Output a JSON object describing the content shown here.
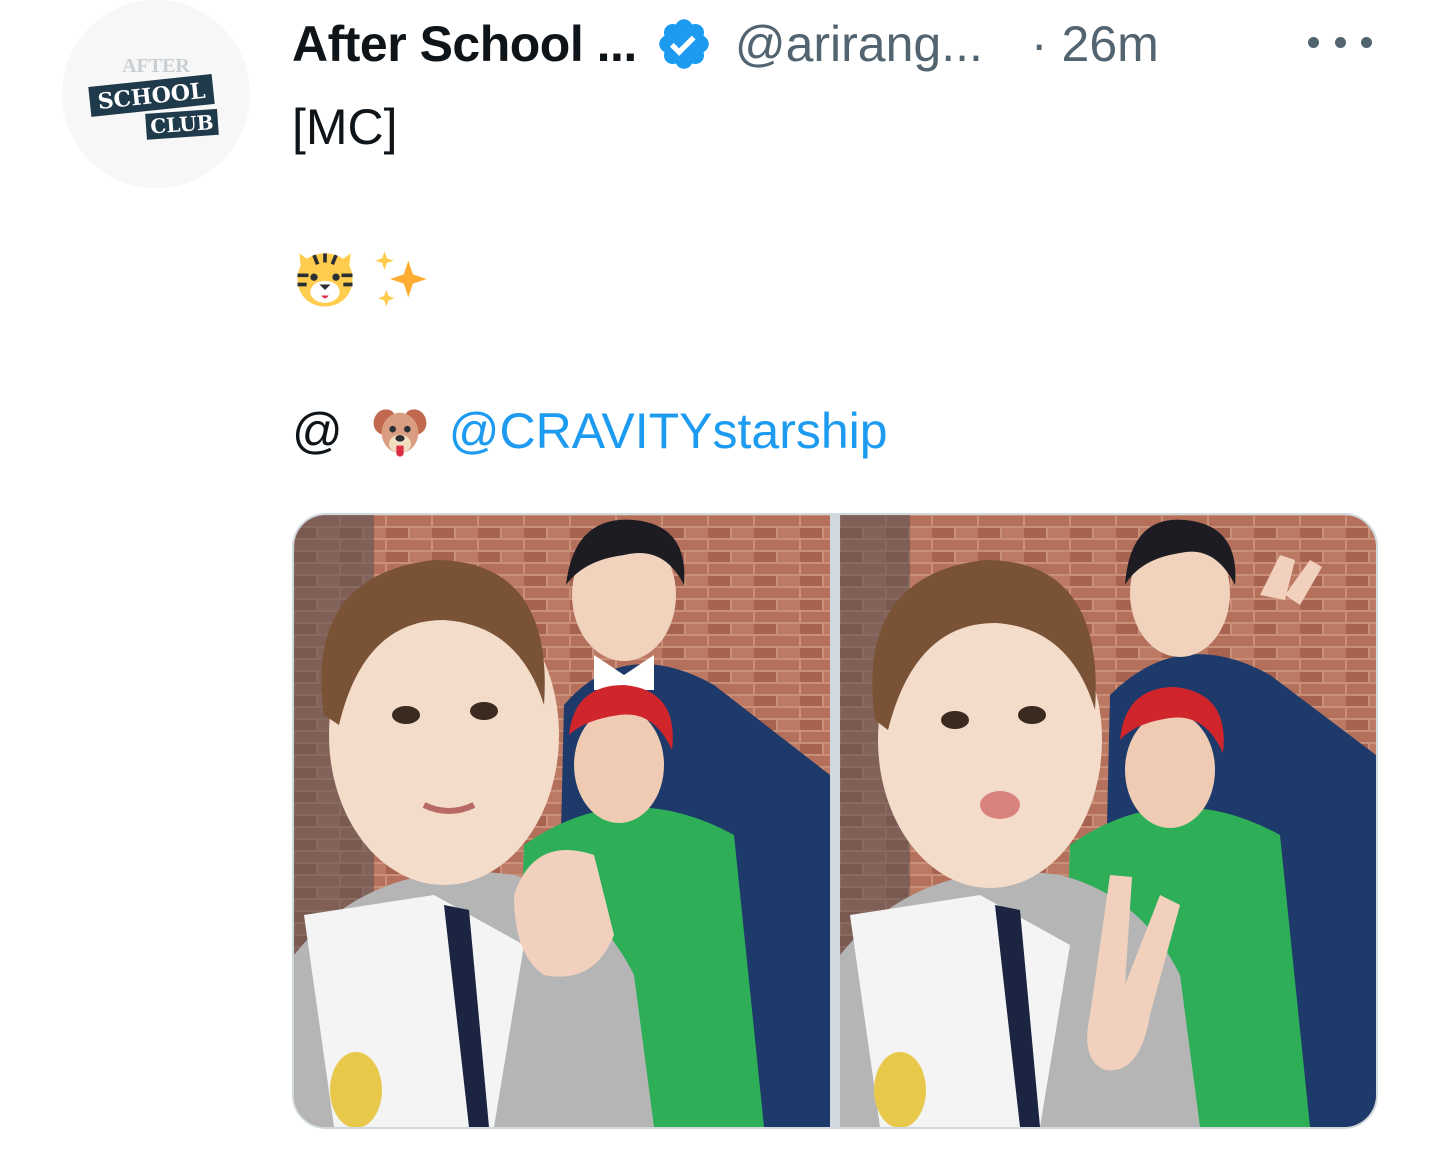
{
  "tweet": {
    "display_name": "After School ...",
    "handle": "@arirang...",
    "separator": "·",
    "timestamp": "26m",
    "lines": {
      "mc": "[MC]",
      "at": "@",
      "mention": "@CRAVITYstarship"
    },
    "emojis": [
      "tiger-face-emoji",
      "sparkles-emoji",
      "dog-face-emoji"
    ],
    "media": {
      "count": 2,
      "photos": [
        "photo-1",
        "photo-2"
      ]
    }
  },
  "avatar": {
    "logo_text_top": "AFTER",
    "logo_text_mid": "SCHOOL",
    "logo_text_bottom": "CLUB"
  },
  "colors": {
    "accent": "#1d9bf0",
    "secondary_text": "#536471",
    "border": "#cfd9de"
  }
}
